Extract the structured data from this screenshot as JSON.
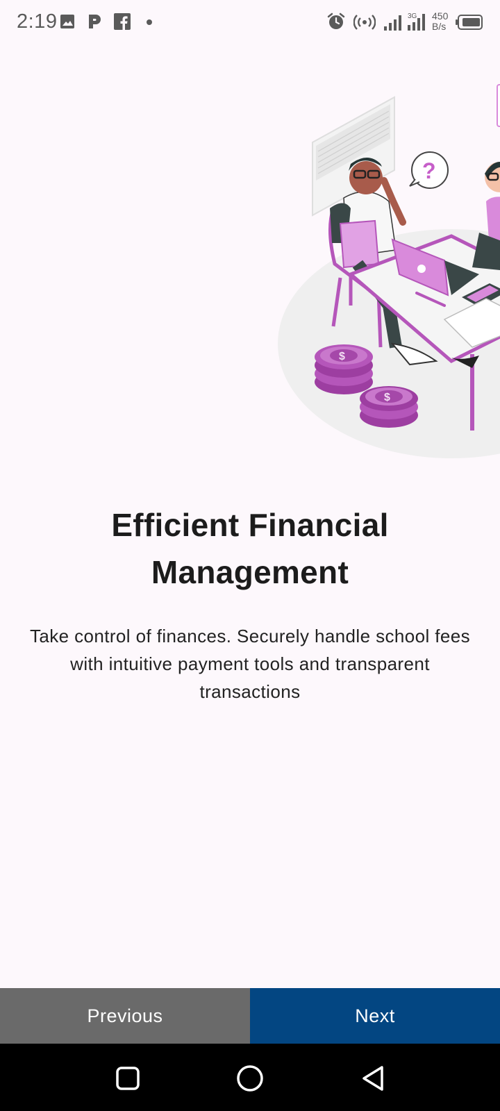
{
  "status_bar": {
    "time": "2:19",
    "net_speed_value": "450",
    "net_speed_unit": "B/s",
    "icons": [
      "image-icon",
      "p-app-icon",
      "facebook-icon",
      "dot-icon",
      "alarm-icon",
      "hotspot-icon",
      "signal-icon",
      "signal-3g-icon",
      "battery-icon"
    ]
  },
  "onboarding": {
    "title": "Efficient Financial Management",
    "description": "Take control of finances. Securely handle school fees with intuitive payment tools and transparent transactions",
    "accent_color": "#c65fc9"
  },
  "buttons": {
    "previous": "Previous",
    "next": "Next",
    "previous_color": "#6a6a6a",
    "next_color": "#034682"
  },
  "nav_bar": {
    "items": [
      "recents-square-icon",
      "home-circle-icon",
      "back-triangle-icon"
    ]
  }
}
